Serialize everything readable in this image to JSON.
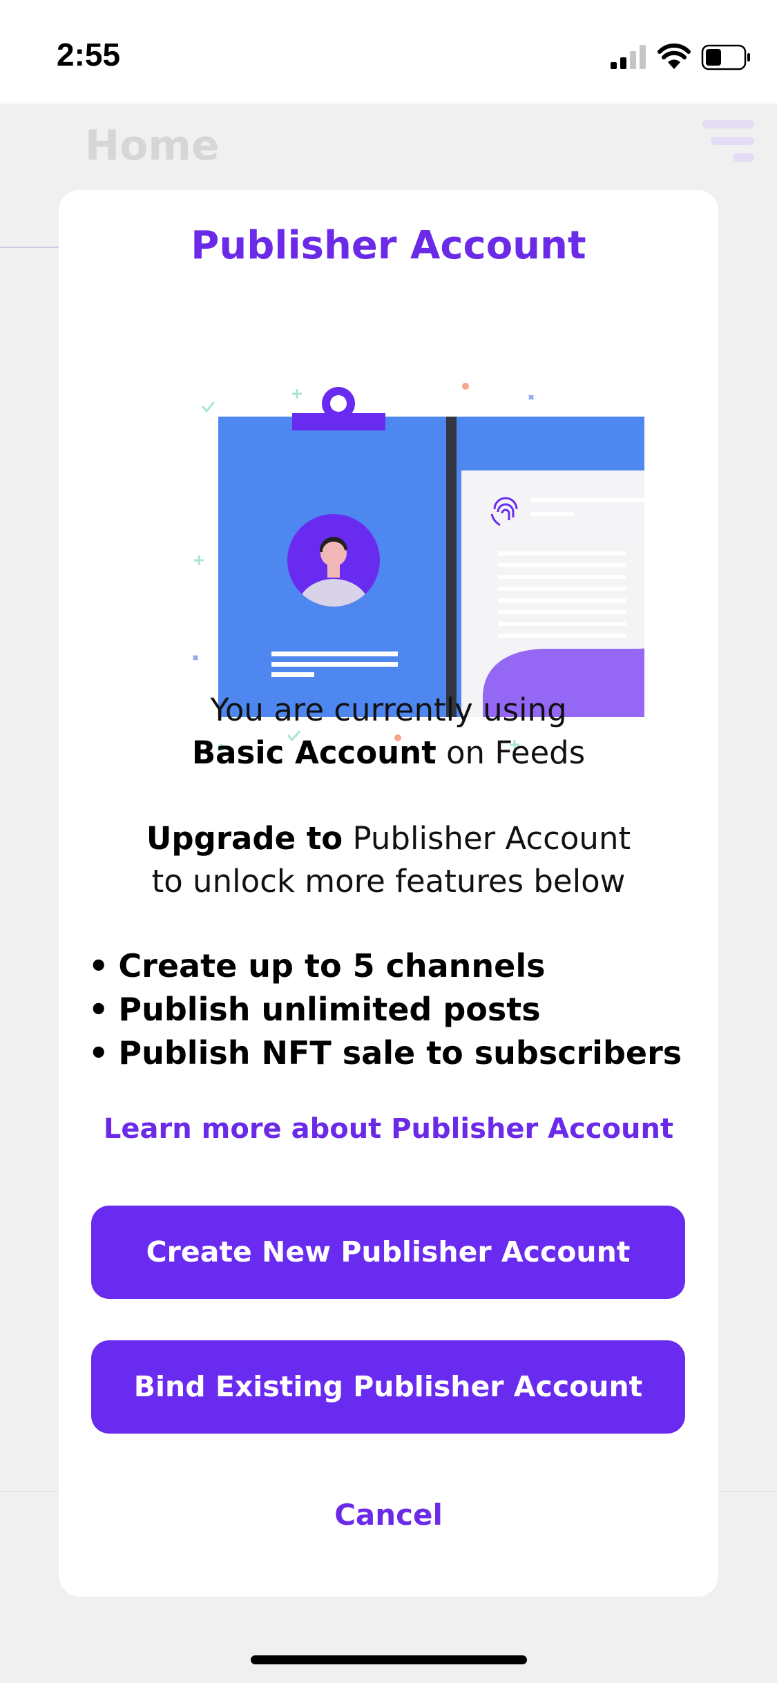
{
  "status_bar": {
    "time": "2:55"
  },
  "background": {
    "title": "Home"
  },
  "modal": {
    "title": "Publisher Account",
    "intro_line1": "You are currently using",
    "intro_bold": "Basic Account",
    "intro_rest": " on Feeds",
    "upgrade_bold": "Upgrade to",
    "upgrade_rest": " Publisher Account",
    "upgrade_line2": "to unlock more features below",
    "features": [
      "Create up to 5 channels",
      "Publish unlimited posts",
      "Publish NFT sale to subscribers"
    ],
    "learn_more": "Learn more about Publisher Account",
    "create_button": "Create New Publisher Account",
    "bind_button": "Bind Existing Publisher Account",
    "cancel": "Cancel"
  },
  "icons": {
    "signal": "cellular-signal-icon",
    "wifi": "wifi-icon",
    "battery": "battery-icon",
    "menu": "filter-menu-icon",
    "fingerprint": "fingerprint-icon",
    "avatar": "avatar-icon",
    "clip": "paperclip-icon"
  },
  "colors": {
    "accent": "#6b2ae8",
    "button": "#6a2bf0",
    "folder_blue": "#4f87f0",
    "purple_blob": "#9468f5"
  }
}
